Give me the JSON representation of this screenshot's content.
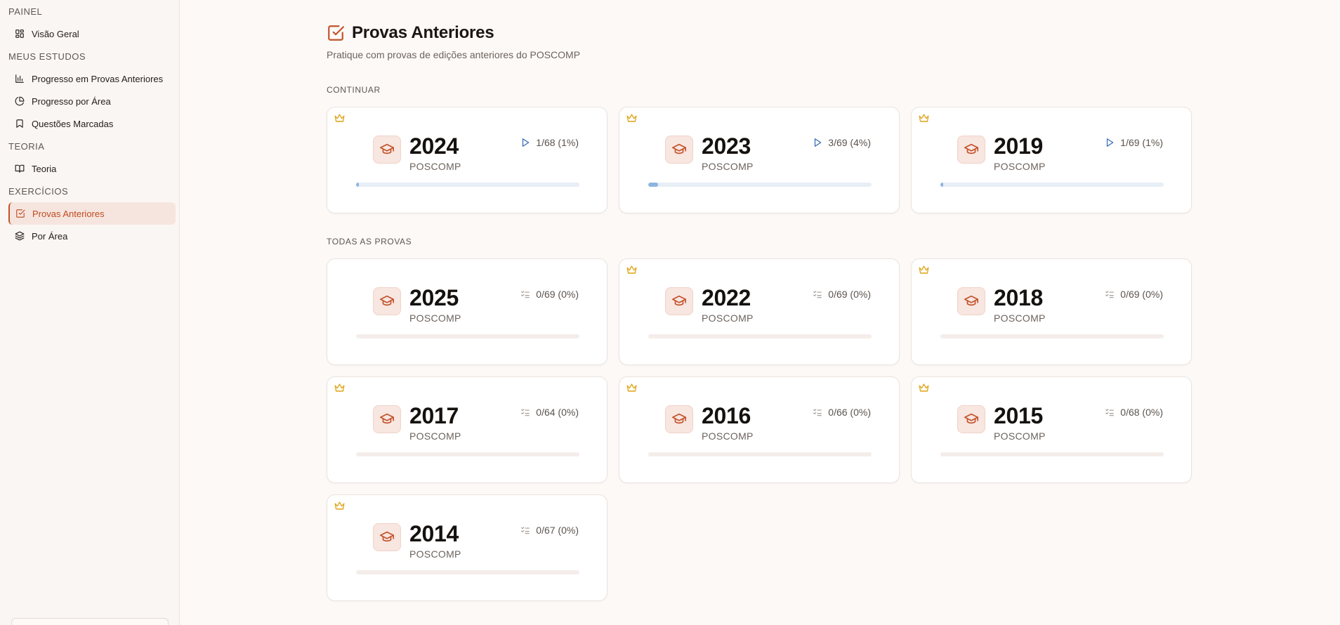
{
  "colors": {
    "accent": "#c3522a",
    "crown": "#e0a820",
    "progress_blue": "#8db4df",
    "play": "#2f66b3"
  },
  "sidebar": {
    "sections": [
      {
        "title": "PAINEL",
        "items": [
          {
            "label": "Visão Geral",
            "icon": "dashboard-icon"
          }
        ]
      },
      {
        "title": "MEUS ESTUDOS",
        "items": [
          {
            "label": "Progresso em Provas Anteriores",
            "icon": "bar-chart-icon"
          },
          {
            "label": "Progresso por Área",
            "icon": "pie-chart-icon"
          },
          {
            "label": "Questões Marcadas",
            "icon": "bookmark-icon"
          }
        ]
      },
      {
        "title": "TEORIA",
        "items": [
          {
            "label": "Teoria",
            "icon": "book-open-icon"
          }
        ]
      },
      {
        "title": "EXERCÍCIOS",
        "items": [
          {
            "label": "Provas Anteriores",
            "icon": "checkbox-icon",
            "active": true
          },
          {
            "label": "Por Área",
            "icon": "layers-icon"
          }
        ]
      }
    ]
  },
  "page": {
    "title": "Provas Anteriores",
    "subtitle": "Pratique com provas de edições anteriores do POSCOMP"
  },
  "continuar": {
    "label": "CONTINUAR",
    "cards": [
      {
        "year": "2024",
        "brand": "POSCOMP",
        "progress_text": "1/68 (1%)",
        "progress": 0.01,
        "premium": true
      },
      {
        "year": "2023",
        "brand": "POSCOMP",
        "progress_text": "3/69 (4%)",
        "progress": 0.04,
        "premium": true
      },
      {
        "year": "2019",
        "brand": "POSCOMP",
        "progress_text": "1/69 (1%)",
        "progress": 0.01,
        "premium": true
      }
    ]
  },
  "todas": {
    "label": "TODAS AS PROVAS",
    "cards": [
      {
        "year": "2025",
        "brand": "POSCOMP",
        "progress_text": "0/69 (0%)",
        "progress": 0,
        "premium": false
      },
      {
        "year": "2022",
        "brand": "POSCOMP",
        "progress_text": "0/69 (0%)",
        "progress": 0,
        "premium": true
      },
      {
        "year": "2018",
        "brand": "POSCOMP",
        "progress_text": "0/69 (0%)",
        "progress": 0,
        "premium": true
      },
      {
        "year": "2017",
        "brand": "POSCOMP",
        "progress_text": "0/64 (0%)",
        "progress": 0,
        "premium": true
      },
      {
        "year": "2016",
        "brand": "POSCOMP",
        "progress_text": "0/66 (0%)",
        "progress": 0,
        "premium": true
      },
      {
        "year": "2015",
        "brand": "POSCOMP",
        "progress_text": "0/68 (0%)",
        "progress": 0,
        "premium": true
      },
      {
        "year": "2014",
        "brand": "POSCOMP",
        "progress_text": "0/67 (0%)",
        "progress": 0,
        "premium": true
      }
    ]
  }
}
